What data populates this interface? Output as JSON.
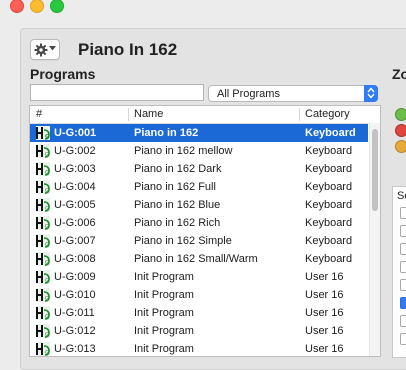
{
  "window": {
    "title": "Piano In 162"
  },
  "header": {
    "patch_title": "Piano In 162"
  },
  "programs": {
    "heading": "Programs",
    "search": {
      "value": "",
      "placeholder": ""
    },
    "filter": {
      "selected": "All Programs"
    },
    "columns": {
      "num": "#",
      "name": "Name",
      "category": "Category"
    },
    "rows": [
      {
        "num": "U-G:001",
        "name": "Piano in 162",
        "category": "Keyboard",
        "selected": true
      },
      {
        "num": "U-G:002",
        "name": "Piano in 162 mellow",
        "category": "Keyboard"
      },
      {
        "num": "U-G:003",
        "name": "Piano in 162 Dark",
        "category": "Keyboard"
      },
      {
        "num": "U-G:004",
        "name": "Piano in 162 Full",
        "category": "Keyboard"
      },
      {
        "num": "U-G:005",
        "name": "Piano in 162 Blue",
        "category": "Keyboard"
      },
      {
        "num": "U-G:006",
        "name": "Piano in 162 Rich",
        "category": "Keyboard"
      },
      {
        "num": "U-G:007",
        "name": "Piano in 162 Simple",
        "category": "Keyboard"
      },
      {
        "num": "U-G:008",
        "name": "Piano in 162 Small/Warm",
        "category": "Keyboard"
      },
      {
        "num": "U-G:009",
        "name": "Init Program",
        "category": "User 16"
      },
      {
        "num": "U-G:010",
        "name": "Init Program",
        "category": "User 16"
      },
      {
        "num": "U-G:011",
        "name": "Init Program",
        "category": "User 16"
      },
      {
        "num": "U-G:012",
        "name": "Init Program",
        "category": "User 16"
      },
      {
        "num": "U-G:013",
        "name": "Init Program",
        "category": "User 16"
      }
    ]
  },
  "zones": {
    "heading": "Zo",
    "list_header": "Se",
    "leds": [
      "green",
      "red",
      "amber"
    ],
    "checkboxes": [
      false,
      false,
      false,
      false,
      false,
      true,
      false,
      false
    ]
  },
  "colors": {
    "selection": "#1a69d6",
    "accent": "#2f7cf6",
    "icon_green": "#1f8a2a"
  },
  "icons": {
    "settings": "gear-icon",
    "program": "program-type-icon"
  }
}
